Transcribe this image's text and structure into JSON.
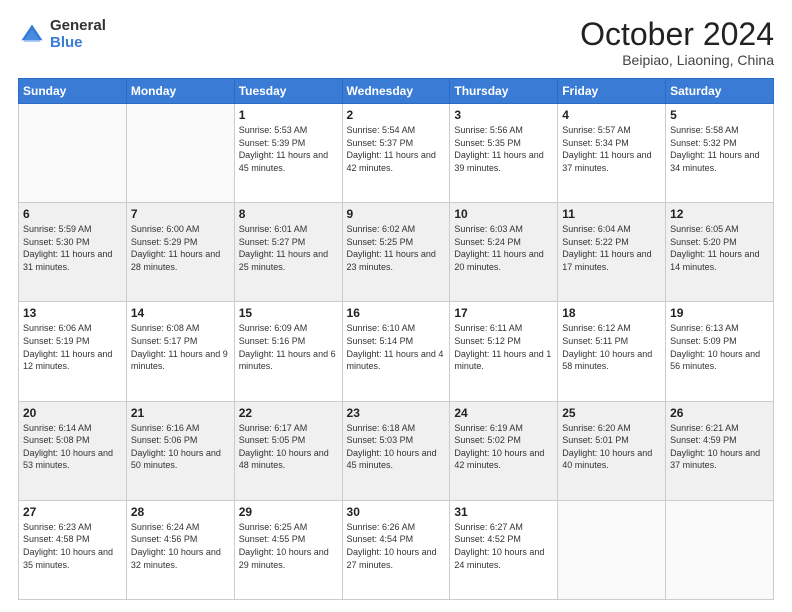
{
  "logo": {
    "general": "General",
    "blue": "Blue"
  },
  "header": {
    "month": "October 2024",
    "location": "Beipiao, Liaoning, China"
  },
  "weekdays": [
    "Sunday",
    "Monday",
    "Tuesday",
    "Wednesday",
    "Thursday",
    "Friday",
    "Saturday"
  ],
  "weeks": [
    [
      {
        "day": "",
        "info": ""
      },
      {
        "day": "",
        "info": ""
      },
      {
        "day": "1",
        "info": "Sunrise: 5:53 AM\nSunset: 5:39 PM\nDaylight: 11 hours and 45 minutes."
      },
      {
        "day": "2",
        "info": "Sunrise: 5:54 AM\nSunset: 5:37 PM\nDaylight: 11 hours and 42 minutes."
      },
      {
        "day": "3",
        "info": "Sunrise: 5:56 AM\nSunset: 5:35 PM\nDaylight: 11 hours and 39 minutes."
      },
      {
        "day": "4",
        "info": "Sunrise: 5:57 AM\nSunset: 5:34 PM\nDaylight: 11 hours and 37 minutes."
      },
      {
        "day": "5",
        "info": "Sunrise: 5:58 AM\nSunset: 5:32 PM\nDaylight: 11 hours and 34 minutes."
      }
    ],
    [
      {
        "day": "6",
        "info": "Sunrise: 5:59 AM\nSunset: 5:30 PM\nDaylight: 11 hours and 31 minutes."
      },
      {
        "day": "7",
        "info": "Sunrise: 6:00 AM\nSunset: 5:29 PM\nDaylight: 11 hours and 28 minutes."
      },
      {
        "day": "8",
        "info": "Sunrise: 6:01 AM\nSunset: 5:27 PM\nDaylight: 11 hours and 25 minutes."
      },
      {
        "day": "9",
        "info": "Sunrise: 6:02 AM\nSunset: 5:25 PM\nDaylight: 11 hours and 23 minutes."
      },
      {
        "day": "10",
        "info": "Sunrise: 6:03 AM\nSunset: 5:24 PM\nDaylight: 11 hours and 20 minutes."
      },
      {
        "day": "11",
        "info": "Sunrise: 6:04 AM\nSunset: 5:22 PM\nDaylight: 11 hours and 17 minutes."
      },
      {
        "day": "12",
        "info": "Sunrise: 6:05 AM\nSunset: 5:20 PM\nDaylight: 11 hours and 14 minutes."
      }
    ],
    [
      {
        "day": "13",
        "info": "Sunrise: 6:06 AM\nSunset: 5:19 PM\nDaylight: 11 hours and 12 minutes."
      },
      {
        "day": "14",
        "info": "Sunrise: 6:08 AM\nSunset: 5:17 PM\nDaylight: 11 hours and 9 minutes."
      },
      {
        "day": "15",
        "info": "Sunrise: 6:09 AM\nSunset: 5:16 PM\nDaylight: 11 hours and 6 minutes."
      },
      {
        "day": "16",
        "info": "Sunrise: 6:10 AM\nSunset: 5:14 PM\nDaylight: 11 hours and 4 minutes."
      },
      {
        "day": "17",
        "info": "Sunrise: 6:11 AM\nSunset: 5:12 PM\nDaylight: 11 hours and 1 minute."
      },
      {
        "day": "18",
        "info": "Sunrise: 6:12 AM\nSunset: 5:11 PM\nDaylight: 10 hours and 58 minutes."
      },
      {
        "day": "19",
        "info": "Sunrise: 6:13 AM\nSunset: 5:09 PM\nDaylight: 10 hours and 56 minutes."
      }
    ],
    [
      {
        "day": "20",
        "info": "Sunrise: 6:14 AM\nSunset: 5:08 PM\nDaylight: 10 hours and 53 minutes."
      },
      {
        "day": "21",
        "info": "Sunrise: 6:16 AM\nSunset: 5:06 PM\nDaylight: 10 hours and 50 minutes."
      },
      {
        "day": "22",
        "info": "Sunrise: 6:17 AM\nSunset: 5:05 PM\nDaylight: 10 hours and 48 minutes."
      },
      {
        "day": "23",
        "info": "Sunrise: 6:18 AM\nSunset: 5:03 PM\nDaylight: 10 hours and 45 minutes."
      },
      {
        "day": "24",
        "info": "Sunrise: 6:19 AM\nSunset: 5:02 PM\nDaylight: 10 hours and 42 minutes."
      },
      {
        "day": "25",
        "info": "Sunrise: 6:20 AM\nSunset: 5:01 PM\nDaylight: 10 hours and 40 minutes."
      },
      {
        "day": "26",
        "info": "Sunrise: 6:21 AM\nSunset: 4:59 PM\nDaylight: 10 hours and 37 minutes."
      }
    ],
    [
      {
        "day": "27",
        "info": "Sunrise: 6:23 AM\nSunset: 4:58 PM\nDaylight: 10 hours and 35 minutes."
      },
      {
        "day": "28",
        "info": "Sunrise: 6:24 AM\nSunset: 4:56 PM\nDaylight: 10 hours and 32 minutes."
      },
      {
        "day": "29",
        "info": "Sunrise: 6:25 AM\nSunset: 4:55 PM\nDaylight: 10 hours and 29 minutes."
      },
      {
        "day": "30",
        "info": "Sunrise: 6:26 AM\nSunset: 4:54 PM\nDaylight: 10 hours and 27 minutes."
      },
      {
        "day": "31",
        "info": "Sunrise: 6:27 AM\nSunset: 4:52 PM\nDaylight: 10 hours and 24 minutes."
      },
      {
        "day": "",
        "info": ""
      },
      {
        "day": "",
        "info": ""
      }
    ]
  ]
}
